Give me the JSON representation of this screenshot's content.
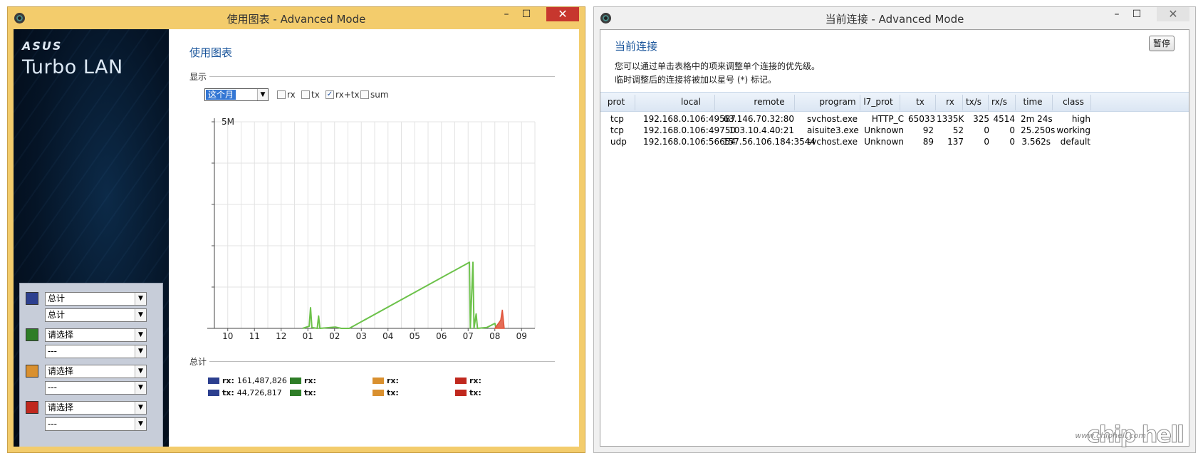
{
  "left_window": {
    "title": "使用图表 - Advanced Mode",
    "controls": {
      "minimize": "–",
      "maximize": "☐",
      "close": "✕"
    },
    "brand": "ASUS",
    "product": "Turbo LAN",
    "heading": "使用图表",
    "display_label": "显示",
    "period_value": "这个月",
    "checkboxes": [
      {
        "label": "rx",
        "checked": false
      },
      {
        "label": "tx",
        "checked": false
      },
      {
        "label": "rx+tx",
        "checked": true
      },
      {
        "label": "sum",
        "checked": false
      }
    ],
    "selectors": [
      {
        "color": "#2c3f8f",
        "primary": "总计",
        "secondary": "总计"
      },
      {
        "color": "#2e7d27",
        "primary": "请选择",
        "secondary": "---"
      },
      {
        "color": "#d9902f",
        "primary": "请选择",
        "secondary": "---"
      },
      {
        "color": "#c0281e",
        "primary": "请选择",
        "secondary": "---"
      }
    ],
    "total_label": "总计",
    "legend": [
      {
        "color": "#2c3f8f",
        "rx_label": "rx:",
        "rx_value": "161,487,826",
        "tx_label": "tx:",
        "tx_value": "44,726,817"
      },
      {
        "color": "#2e7d27",
        "rx_label": "rx:",
        "rx_value": "",
        "tx_label": "tx:",
        "tx_value": ""
      },
      {
        "color": "#d9902f",
        "rx_label": "rx:",
        "rx_value": "",
        "tx_label": "tx:",
        "tx_value": ""
      },
      {
        "color": "#c0281e",
        "rx_label": "rx:",
        "rx_value": "",
        "tx_label": "tx:",
        "tx_value": ""
      }
    ]
  },
  "chart_data": {
    "type": "line",
    "title": "",
    "xlabel": "",
    "ylabel": "",
    "categories": [
      "10",
      "11",
      "12",
      "01",
      "02",
      "03",
      "04",
      "05",
      "06",
      "07",
      "08",
      "09"
    ],
    "y_tick_label": "5M",
    "ylim": [
      0,
      5
    ],
    "grid": true,
    "series": [
      {
        "color": "#6cc24a",
        "points": [
          [
            3.3,
            0
          ],
          [
            3.55,
            0.05
          ],
          [
            3.6,
            0.5
          ],
          [
            3.65,
            0.02
          ],
          [
            3.85,
            0
          ],
          [
            3.9,
            0.3
          ],
          [
            3.95,
            0
          ],
          [
            4.5,
            0.03
          ],
          [
            4.55,
            0.03
          ],
          [
            4.75,
            0
          ],
          [
            5.05,
            0
          ],
          [
            9.55,
            1.6
          ],
          [
            9.58,
            0
          ],
          [
            9.68,
            1.6
          ],
          [
            9.72,
            0
          ],
          [
            9.8,
            0.35
          ],
          [
            9.85,
            0
          ],
          [
            10.2,
            0.02
          ],
          [
            10.5,
            0.12
          ],
          [
            10.55,
            0
          ]
        ]
      },
      {
        "color": "#e0533a",
        "points": [
          [
            10.5,
            0
          ],
          [
            10.72,
            0.2
          ],
          [
            10.78,
            0.45
          ],
          [
            10.85,
            0
          ]
        ]
      }
    ]
  },
  "right_window": {
    "title": "当前连接 - Advanced Mode",
    "controls": {
      "minimize": "–",
      "maximize": "☐",
      "close": "✕"
    },
    "heading": "当前连接",
    "pause_label": "暂停",
    "desc_line1": "您可以通过单击表格中的项来调整单个连接的优先级。",
    "desc_line2": "临时调整后的连接将被加以星号 (*) 标记。",
    "columns": [
      "prot",
      "local",
      "remote",
      "program",
      "l7_prot",
      "tx",
      "rx",
      "tx/s",
      "rx/s",
      "time",
      "class"
    ],
    "rows": [
      [
        "tcp",
        "192.168.0.106:49587",
        "63.146.70.32:80",
        "svchost.exe",
        "HTTP_C",
        "65033",
        "1335K",
        "325",
        "4514",
        "2m 24s",
        "high"
      ],
      [
        "tcp",
        "192.168.0.106:49750",
        "103.10.4.40:21",
        "aisuite3.exe",
        "Unknown",
        "92",
        "52",
        "0",
        "0",
        "25.250s",
        "working"
      ],
      [
        "udp",
        "192.168.0.106:56654",
        "157.56.106.184:3544",
        "svchost.exe",
        "Unknown",
        "89",
        "137",
        "0",
        "0",
        "3.562s",
        "default"
      ]
    ],
    "watermark_url": "www.chiphell.com",
    "watermark_logo": "chip hell"
  }
}
